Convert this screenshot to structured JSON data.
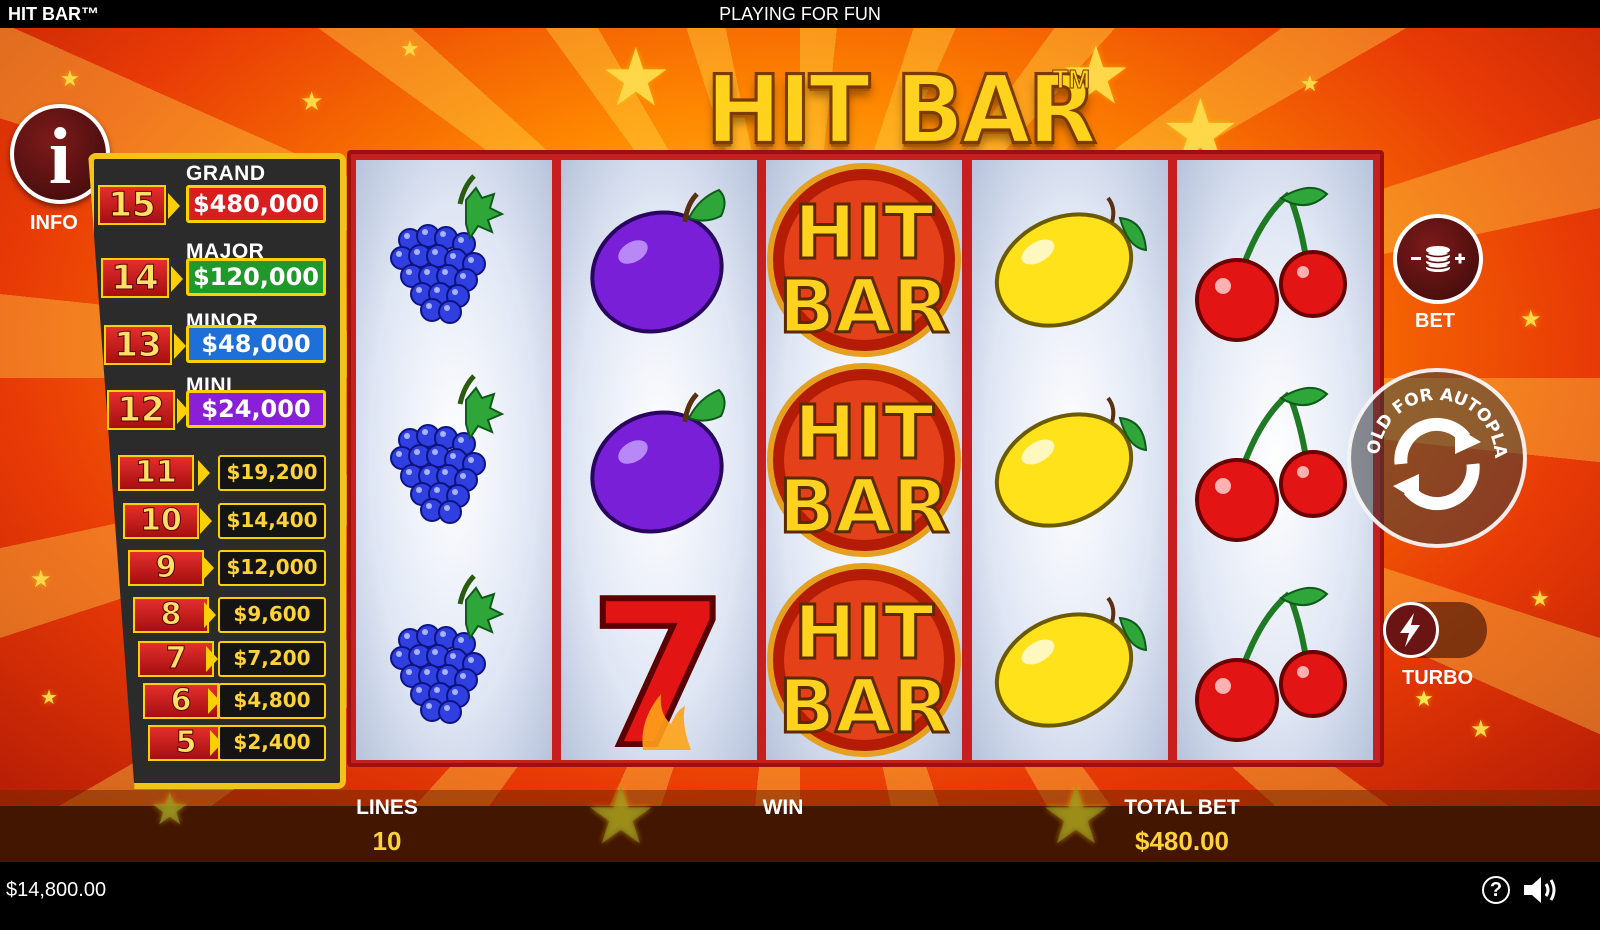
{
  "top_bar": {
    "title": "HIT BAR™",
    "mode": "PLAYING FOR FUN"
  },
  "logo": {
    "text": "HIT BAR",
    "tm": "TM"
  },
  "info_button": {
    "glyph": "i",
    "label": "INFO",
    "icon": "info-icon"
  },
  "paytable": {
    "jackpots": [
      {
        "count": "15",
        "name": "GRAND",
        "value": "$480,000",
        "color": "#d81f1f"
      },
      {
        "count": "14",
        "name": "MAJOR",
        "value": "$120,000",
        "color": "#1f9a2a"
      },
      {
        "count": "13",
        "name": "MINOR",
        "value": "$48,000",
        "color": "#1f6fd8"
      },
      {
        "count": "12",
        "name": "MINI",
        "value": "$24,000",
        "color": "#8a1fd8"
      }
    ],
    "prizes": [
      {
        "count": "11",
        "value": "$19,200"
      },
      {
        "count": "10",
        "value": "$14,400"
      },
      {
        "count": "9",
        "value": "$12,000"
      },
      {
        "count": "8",
        "value": "$9,600"
      },
      {
        "count": "7",
        "value": "$7,200"
      },
      {
        "count": "6",
        "value": "$4,800"
      },
      {
        "count": "5",
        "value": "$2,400"
      }
    ]
  },
  "reels": [
    [
      "grapes",
      "grapes",
      "grapes"
    ],
    [
      "plum",
      "plum",
      "seven"
    ],
    [
      "hit-bar",
      "hit-bar",
      "hit-bar"
    ],
    [
      "lemon",
      "lemon",
      "lemon"
    ],
    [
      "cherries",
      "cherries",
      "cherries"
    ]
  ],
  "hitbar_symbol": {
    "line1": "HIT",
    "line2": "BAR"
  },
  "seven_symbol": {
    "text": "7"
  },
  "controls": {
    "bet_label": "BET",
    "autoplay_label": "HOLD FOR AUTOPLAY",
    "turbo_label": "TURBO"
  },
  "info_bar": {
    "lines_label": "LINES",
    "lines_value": "10",
    "win_label": "WIN",
    "total_bet_label": "TOTAL BET",
    "total_bet_value": "$480.00"
  },
  "bottom_bar": {
    "balance": "$14,800.00",
    "help_glyph": "?"
  }
}
